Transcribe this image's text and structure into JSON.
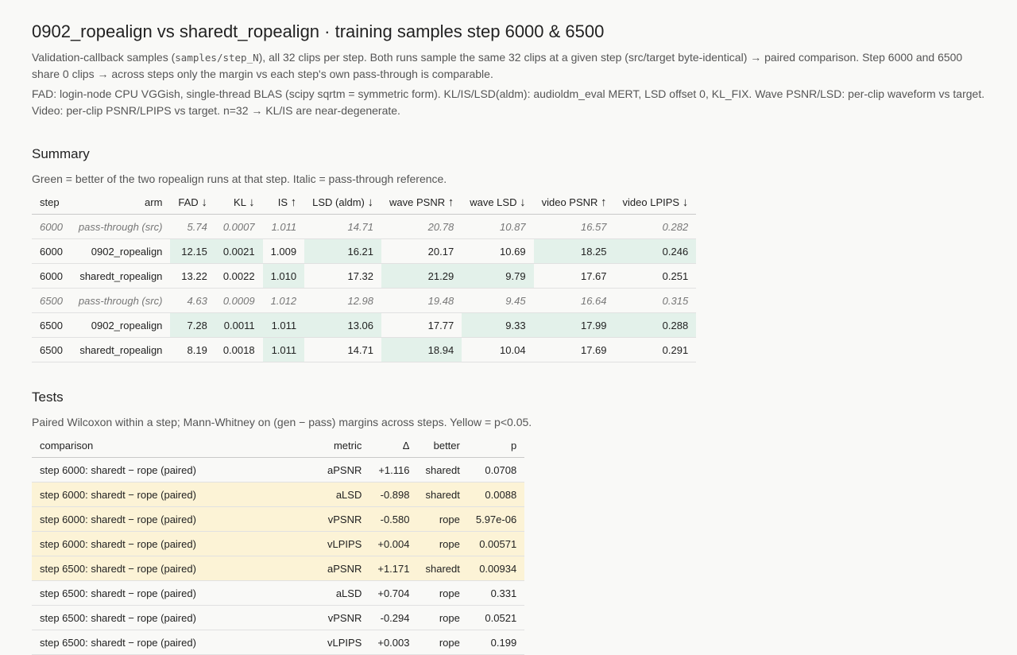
{
  "title": "0902_ropealign vs sharedt_ropealign · training samples step 6000 & 6500",
  "desc1": {
    "pre": "Validation-callback samples (",
    "code": "samples/step_N",
    "post": "), all 32 clips per step. Both runs sample the same 32 clips at a given step (src/target byte-identical) → paired comparison. Step 6000 and 6500 share 0 clips → across steps only the margin vs each step's own pass-through is comparable."
  },
  "desc2": "FAD: login-node CPU VGGish, single-thread BLAS (scipy sqrtm = symmetric form). KL/IS/LSD(aldm): audioldm_eval MERT, LSD offset 0, KL_FIX. Wave PSNR/LSD: per-clip waveform vs target. Video: per-clip PSNR/LPIPS vs target. n=32 → KL/IS are near-degenerate.",
  "summary": {
    "heading": "Summary",
    "note": "Green = better of the two ropealign runs at that step. Italic = pass-through reference.",
    "columns": [
      {
        "label": "step",
        "arrow": ""
      },
      {
        "label": "arm",
        "arrow": ""
      },
      {
        "label": "FAD",
        "arrow": "↓"
      },
      {
        "label": "KL",
        "arrow": "↓"
      },
      {
        "label": "IS",
        "arrow": "↑"
      },
      {
        "label": "LSD (aldm)",
        "arrow": "↓"
      },
      {
        "label": "wave PSNR",
        "arrow": "↑"
      },
      {
        "label": "wave LSD",
        "arrow": "↓"
      },
      {
        "label": "video PSNR",
        "arrow": "↑"
      },
      {
        "label": "video LPIPS",
        "arrow": "↓"
      }
    ],
    "rows": [
      {
        "pass": true,
        "cells": [
          "6000",
          "pass-through (src)",
          "5.74",
          "0.0007",
          "1.011",
          "14.71",
          "20.78",
          "10.87",
          "16.57",
          "0.282"
        ],
        "good": [
          false,
          false,
          false,
          false,
          false,
          false,
          false,
          false,
          false,
          false
        ]
      },
      {
        "pass": false,
        "cells": [
          "6000",
          "0902_ropealign",
          "12.15",
          "0.0021",
          "1.009",
          "16.21",
          "20.17",
          "10.69",
          "18.25",
          "0.246"
        ],
        "good": [
          false,
          false,
          true,
          true,
          false,
          true,
          false,
          false,
          true,
          true
        ]
      },
      {
        "pass": false,
        "cells": [
          "6000",
          "sharedt_ropealign",
          "13.22",
          "0.0022",
          "1.010",
          "17.32",
          "21.29",
          "9.79",
          "17.67",
          "0.251"
        ],
        "good": [
          false,
          false,
          false,
          false,
          true,
          false,
          true,
          true,
          false,
          false
        ]
      },
      {
        "pass": true,
        "cells": [
          "6500",
          "pass-through (src)",
          "4.63",
          "0.0009",
          "1.012",
          "12.98",
          "19.48",
          "9.45",
          "16.64",
          "0.315"
        ],
        "good": [
          false,
          false,
          false,
          false,
          false,
          false,
          false,
          false,
          false,
          false
        ]
      },
      {
        "pass": false,
        "cells": [
          "6500",
          "0902_ropealign",
          "7.28",
          "0.0011",
          "1.011",
          "13.06",
          "17.77",
          "9.33",
          "17.99",
          "0.288"
        ],
        "good": [
          false,
          false,
          true,
          true,
          true,
          true,
          false,
          true,
          true,
          true
        ]
      },
      {
        "pass": false,
        "cells": [
          "6500",
          "sharedt_ropealign",
          "8.19",
          "0.0018",
          "1.011",
          "14.71",
          "18.94",
          "10.04",
          "17.69",
          "0.291"
        ],
        "good": [
          false,
          false,
          false,
          false,
          true,
          false,
          true,
          false,
          false,
          false
        ]
      }
    ]
  },
  "tests": {
    "heading": "Tests",
    "note": "Paired Wilcoxon within a step; Mann-Whitney on (gen − pass) margins across steps. Yellow = p<0.05.",
    "columns": [
      "comparison",
      "metric",
      "Δ",
      "better",
      "p"
    ],
    "rows": [
      {
        "sig": false,
        "cells": [
          "step 6000: sharedt − rope (paired)",
          "aPSNR",
          "+1.116",
          "sharedt",
          "0.0708"
        ]
      },
      {
        "sig": true,
        "cells": [
          "step 6000: sharedt − rope (paired)",
          "aLSD",
          "-0.898",
          "sharedt",
          "0.0088"
        ]
      },
      {
        "sig": true,
        "cells": [
          "step 6000: sharedt − rope (paired)",
          "vPSNR",
          "-0.580",
          "rope",
          "5.97e-06"
        ]
      },
      {
        "sig": true,
        "cells": [
          "step 6000: sharedt − rope (paired)",
          "vLPIPS",
          "+0.004",
          "rope",
          "0.00571"
        ]
      },
      {
        "sig": true,
        "cells": [
          "step 6500: sharedt − rope (paired)",
          "aPSNR",
          "+1.171",
          "sharedt",
          "0.00934"
        ]
      },
      {
        "sig": false,
        "cells": [
          "step 6500: sharedt − rope (paired)",
          "aLSD",
          "+0.704",
          "rope",
          "0.331"
        ]
      },
      {
        "sig": false,
        "cells": [
          "step 6500: sharedt − rope (paired)",
          "vPSNR",
          "-0.294",
          "rope",
          "0.0521"
        ]
      },
      {
        "sig": false,
        "cells": [
          "step 6500: sharedt − rope (paired)",
          "vLPIPS",
          "+0.003",
          "rope",
          "0.199"
        ]
      }
    ]
  }
}
